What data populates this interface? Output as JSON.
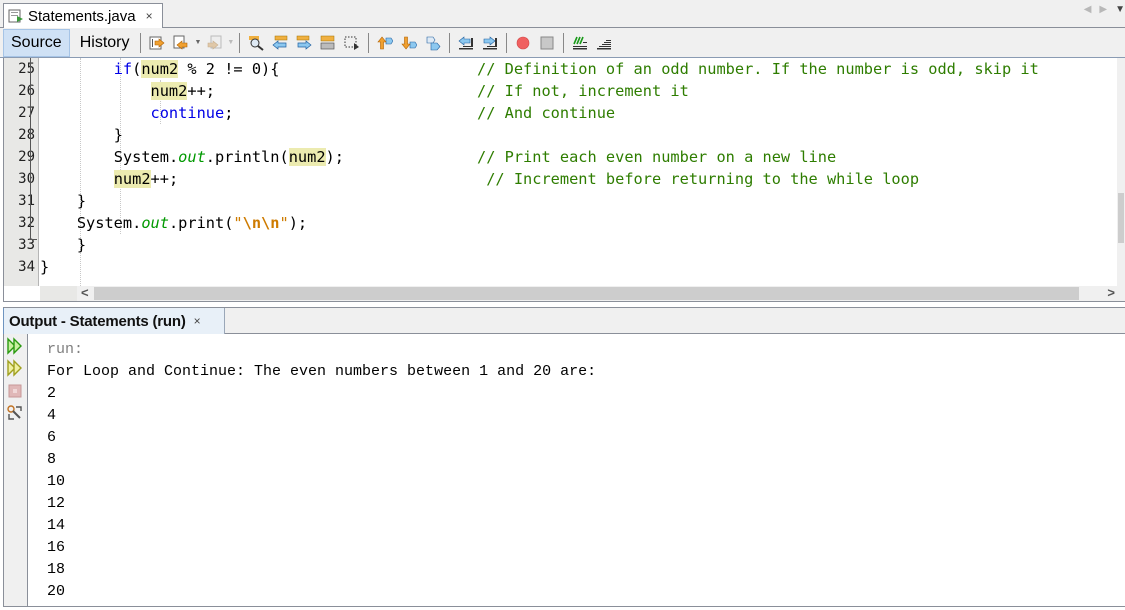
{
  "editor_tab": {
    "filename": "Statements.java",
    "close_glyph": "×",
    "nav_left": "◀",
    "nav_right": "▶",
    "nav_menu": "▼"
  },
  "toolbar": {
    "source_label": "Source",
    "history_label": "History",
    "active_view": "Source",
    "buttons": [
      "last-edit-icon",
      "back-icon",
      "forward-icon",
      "find-selection-icon",
      "find-previous-icon",
      "find-next-icon",
      "toggle-highlight-icon",
      "toggle-rectangular-selection-icon",
      "previous-bookmark-icon",
      "next-bookmark-icon",
      "toggle-bookmark-icon",
      "shift-left-icon",
      "shift-right-icon",
      "start-macro-icon",
      "stop-macro-icon",
      "comment-icon",
      "uncomment-icon"
    ]
  },
  "code": {
    "line_numbers": [
      "25",
      "26",
      "27",
      "28",
      "29",
      "30",
      "31",
      "32",
      "33",
      "34"
    ],
    "lines": [
      {
        "indent": "        ",
        "parts": [
          {
            "t": "if",
            "c": "kw"
          },
          {
            "t": "(",
            "c": ""
          },
          {
            "t": "num2",
            "c": "hl"
          },
          {
            "t": " % 2 != 0){",
            "c": ""
          }
        ],
        "comment": "// Definition of an odd number. If the number is odd, skip it",
        "comment_col": 34
      },
      {
        "indent": "            ",
        "parts": [
          {
            "t": "num2",
            "c": "hl"
          },
          {
            "t": "++;",
            "c": ""
          }
        ],
        "comment": "// If not, increment it",
        "comment_col": 34
      },
      {
        "indent": "            ",
        "parts": [
          {
            "t": "continue",
            "c": "kw"
          },
          {
            "t": ";",
            "c": ""
          }
        ],
        "comment": "// And continue",
        "comment_col": 34
      },
      {
        "indent": "        ",
        "parts": [
          {
            "t": "}",
            "c": ""
          }
        ],
        "comment": "",
        "comment_col": 34
      },
      {
        "indent": "        ",
        "parts": [
          {
            "t": "System.",
            "c": ""
          },
          {
            "t": "out",
            "c": "fld"
          },
          {
            "t": ".println(",
            "c": ""
          },
          {
            "t": "num2",
            "c": "hl"
          },
          {
            "t": ");",
            "c": ""
          }
        ],
        "comment": "// Print each even number on a new line",
        "comment_col": 34
      },
      {
        "indent": "        ",
        "parts": [
          {
            "t": "num2",
            "c": "hl"
          },
          {
            "t": "++;",
            "c": ""
          }
        ],
        "comment": " // Increment before returning to the while loop",
        "comment_col": 34
      },
      {
        "indent": "    ",
        "parts": [
          {
            "t": "}",
            "c": ""
          }
        ],
        "comment": "",
        "comment_col": 34
      },
      {
        "indent": "    ",
        "parts": [
          {
            "t": "System.",
            "c": ""
          },
          {
            "t": "out",
            "c": "fld"
          },
          {
            "t": ".print(",
            "c": ""
          },
          {
            "t": "\"",
            "c": "str"
          },
          {
            "t": "\\n\\n",
            "c": "esc"
          },
          {
            "t": "\"",
            "c": "str"
          },
          {
            "t": ");",
            "c": ""
          }
        ],
        "comment": "",
        "comment_col": 34
      },
      {
        "indent": "    ",
        "parts": [
          {
            "t": "}",
            "c": ""
          }
        ],
        "comment": "",
        "comment_col": 34
      },
      {
        "indent": "",
        "parts": [
          {
            "t": "}",
            "c": ""
          }
        ],
        "comment": "",
        "comment_col": 34
      }
    ]
  },
  "scroll": {
    "left_arrow": "<",
    "right_arrow": ">"
  },
  "output": {
    "tab_label": "Output - Statements (run)",
    "close_glyph": "×",
    "side_buttons": [
      "rerun-icon",
      "rerun-with-params-icon",
      "stop-icon",
      "settings-icon"
    ],
    "lines": [
      "run:",
      "For Loop and Continue: The even numbers between 1 and 20 are:",
      "2",
      "4",
      "6",
      "8",
      "10",
      "12",
      "14",
      "16",
      "18",
      "20"
    ]
  },
  "colors": {
    "keyword": "#0000e6",
    "field": "#009900",
    "string": "#ce7b00",
    "comment": "#2e7d00",
    "occurrence_highlight": "#ecebb0",
    "active_tab": "#cfe1f5"
  }
}
